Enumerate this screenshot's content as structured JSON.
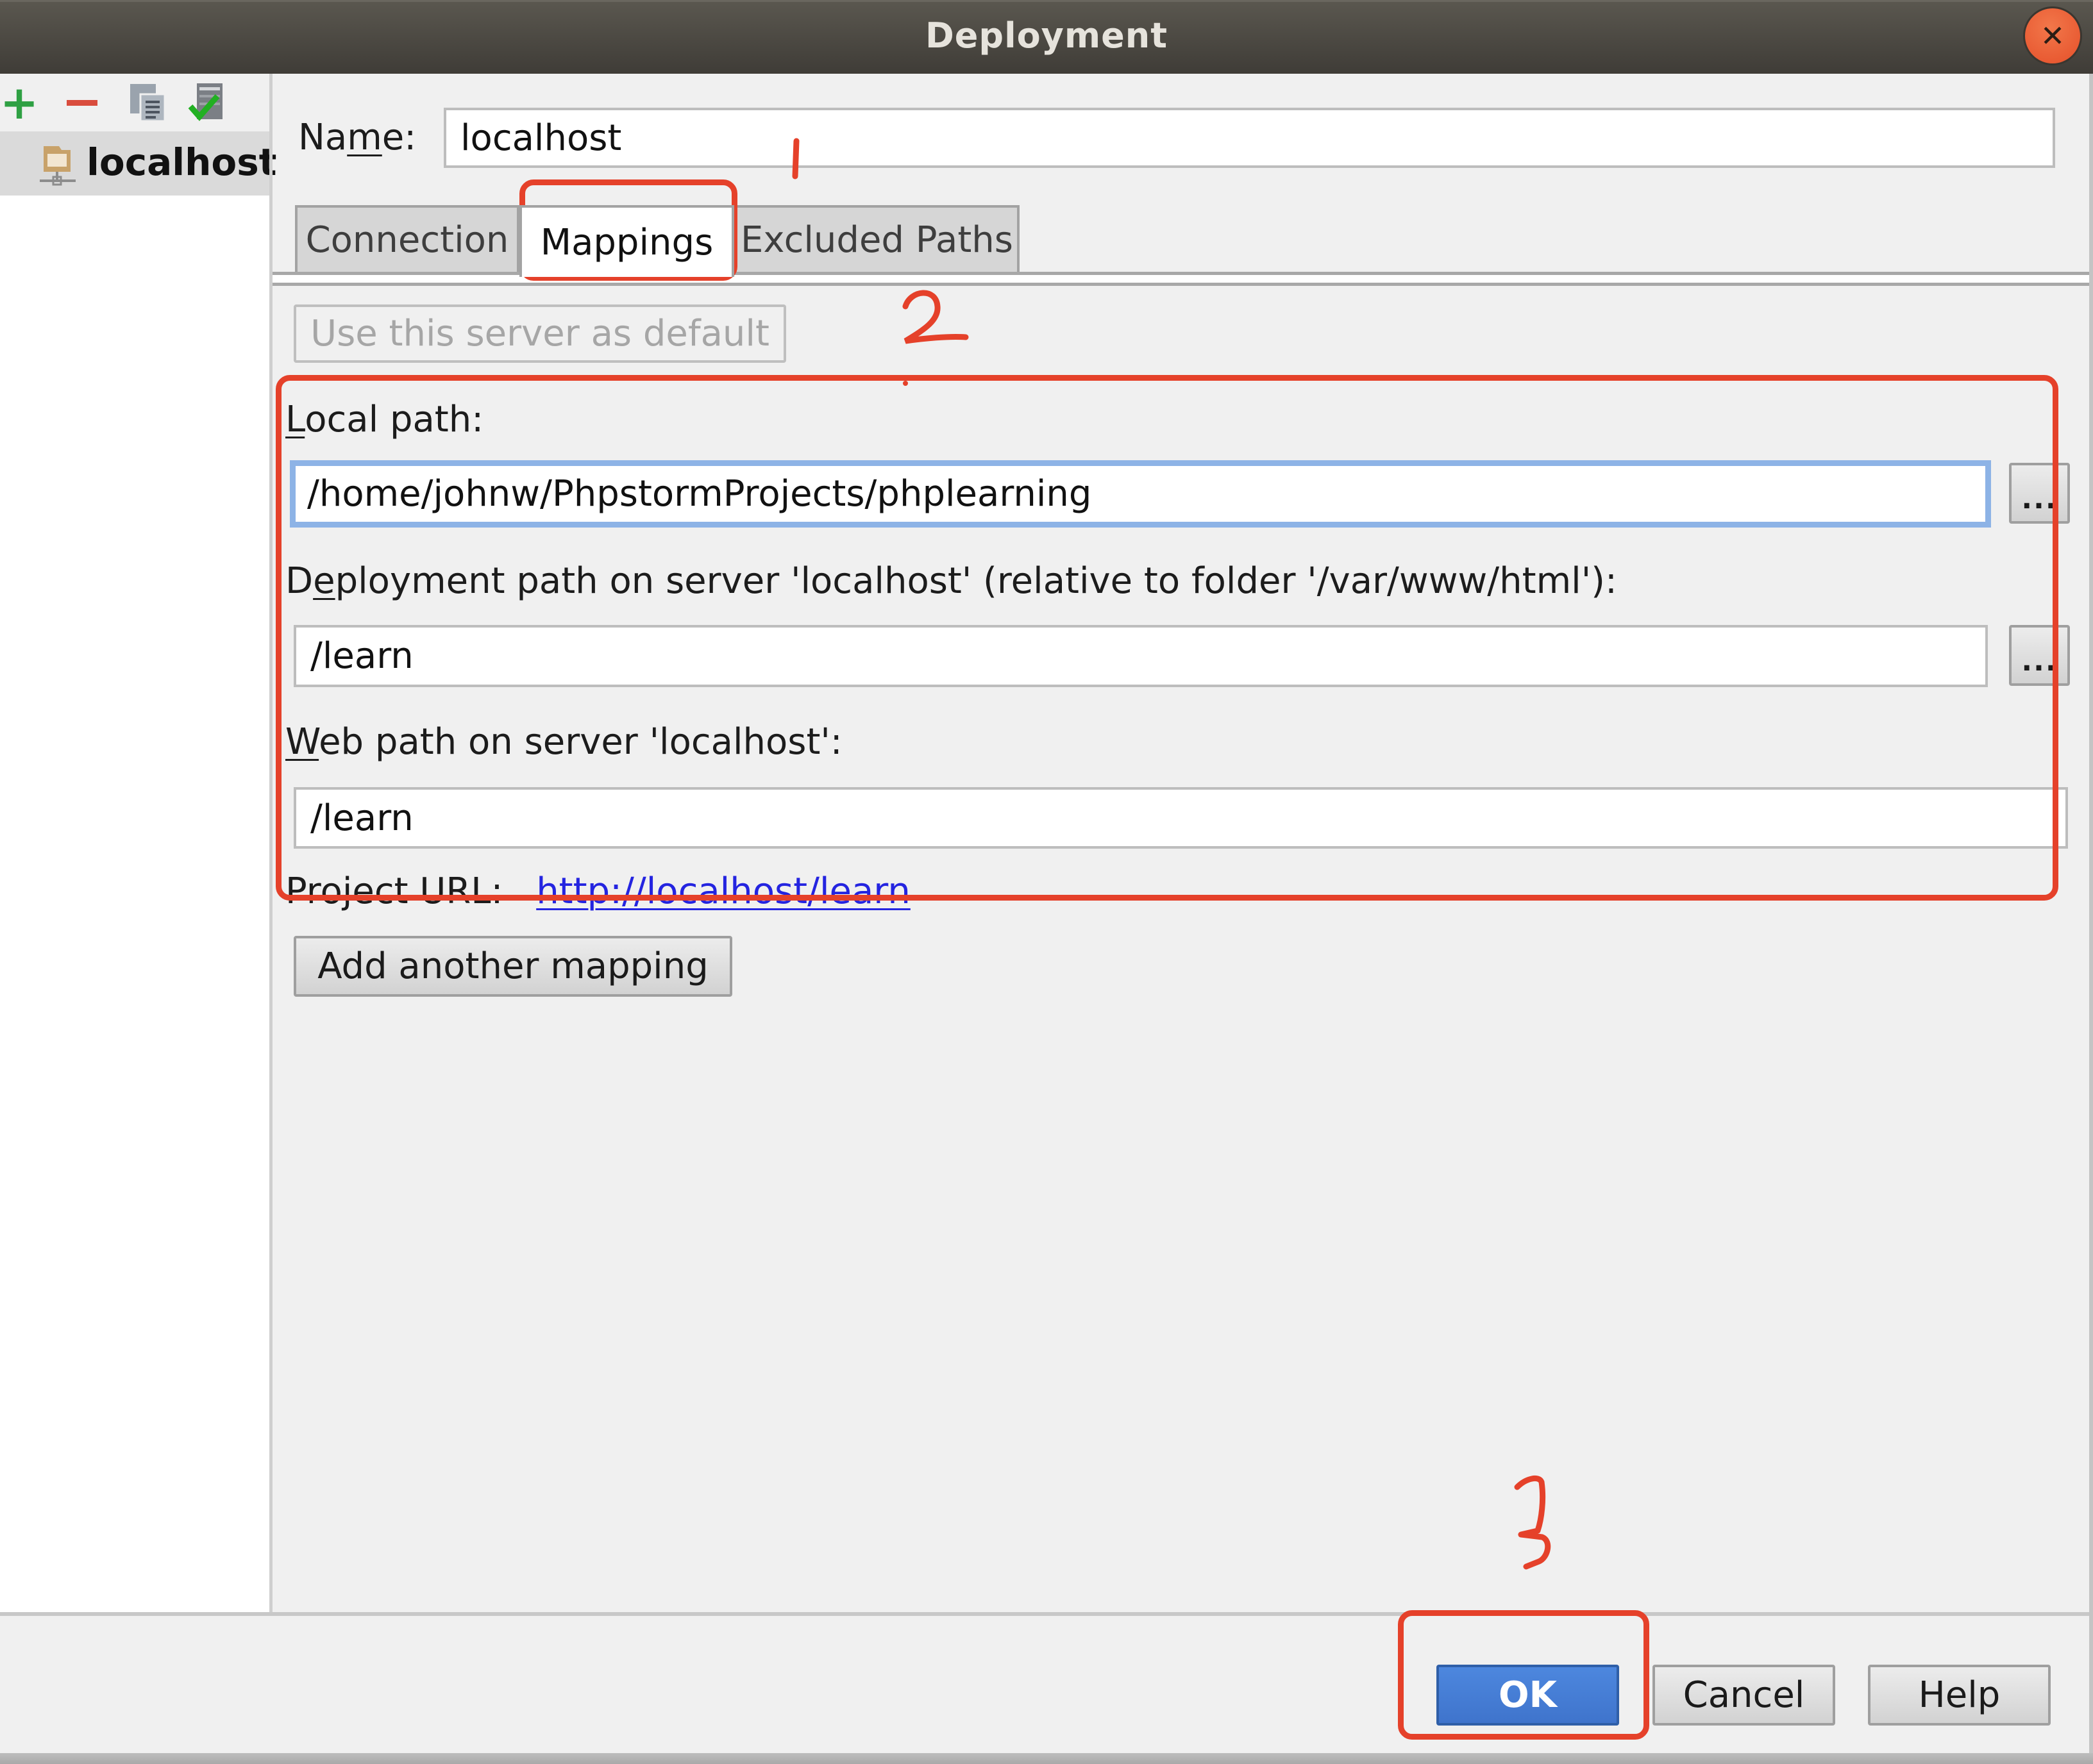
{
  "window": {
    "title": "Deployment",
    "close_icon": "close-icon"
  },
  "sidebar": {
    "toolbar": [
      {
        "name": "add-server-button",
        "icon": "plus-icon",
        "glyph": "+",
        "color": "#2ea043"
      },
      {
        "name": "remove-server-button",
        "icon": "minus-icon",
        "color": "#d94c3d"
      },
      {
        "name": "copy-server-button",
        "icon": "copy-icon"
      },
      {
        "name": "set-default-server-button",
        "icon": "server-check-icon",
        "color": "#2db52d"
      }
    ],
    "servers": [
      {
        "label": "localhost",
        "icon": "sftp-server-icon",
        "selected": true
      }
    ]
  },
  "form": {
    "name_label_pre": "Na",
    "name_label_mnemonic": "m",
    "name_label_post": "e:",
    "name_value": "localhost"
  },
  "tabs": [
    {
      "label": "Connection",
      "active": false
    },
    {
      "label": "Mappings",
      "active": true
    },
    {
      "label": "Excluded Paths",
      "active": false
    }
  ],
  "mappings": {
    "use_default_button": "Use this server as default",
    "local_path_label_mnemonic": "L",
    "local_path_label_rest": "ocal path:",
    "local_path_value": "/home/johnw/PhpstormProjects/phplearning",
    "deployment_path_label_pre": "D",
    "deployment_path_label_mnemonic": "e",
    "deployment_path_label_rest": "ployment path on server 'localhost' (relative to folder '/var/www/html'):",
    "deployment_path_value": "/learn",
    "web_path_label_mnemonic": "W",
    "web_path_label_rest": "eb path on server 'localhost':",
    "web_path_value": "/learn",
    "browse_button": "...",
    "project_url_label": "Project URL:",
    "project_url_value": "http://localhost/learn",
    "add_mapping_button": "Add another mapping"
  },
  "footer": {
    "ok": "OK",
    "cancel": "Cancel",
    "help": "Help"
  },
  "annotations": {
    "color": "#e5412a",
    "marks": [
      "1",
      "2",
      "3"
    ]
  }
}
